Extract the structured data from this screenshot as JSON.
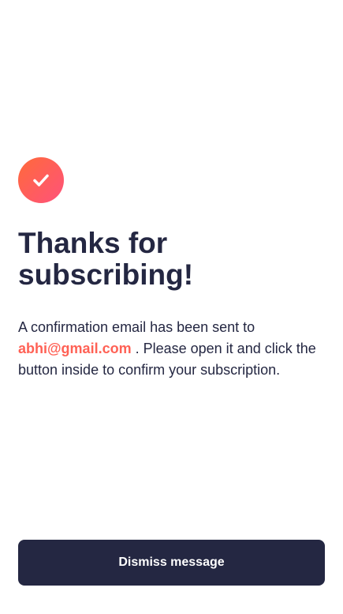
{
  "success": {
    "title_line_1": "Thanks for",
    "title_line_2": "subscribing!",
    "message_before_email": "A confirmation email has been sent to",
    "email": "abhi@gmail.com",
    "message_after_email": ". Please open it and click the button inside to confirm your subscription.",
    "dismiss_label": "Dismiss message"
  },
  "icons": {
    "success": "check-circle-icon"
  },
  "colors": {
    "primary_dark": "#242742",
    "accent": "#ff6155",
    "icon_gradient_start": "#ff6a3a",
    "icon_gradient_end": "#ff527b",
    "background": "#ffffff"
  }
}
